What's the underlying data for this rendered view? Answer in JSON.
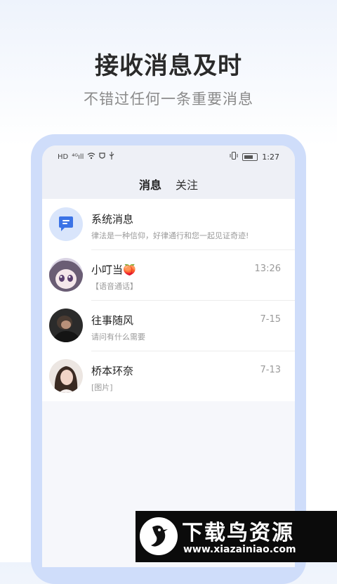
{
  "promo": {
    "headline": "接收消息及时",
    "subline": "不错过任何一条重要消息"
  },
  "statusbar": {
    "left_icons": [
      "HD",
      "4G-signal",
      "wifi",
      "usb"
    ],
    "time": "1:27"
  },
  "tabs": [
    {
      "label": "消息",
      "active": true
    },
    {
      "label": "关注",
      "active": false
    }
  ],
  "messages": [
    {
      "title": "系统消息",
      "preview": "律法是一种信仰，好律通行和您一起见证奇迹!",
      "time": "",
      "icon": "chat-bubble-icon"
    },
    {
      "title": "小叮当🍑",
      "preview": "【语音通话】",
      "time": "13:26",
      "icon": "avatar"
    },
    {
      "title": "往事随风",
      "preview": "请问有什么需要",
      "time": "7-15",
      "icon": "avatar"
    },
    {
      "title": "桥本环奈",
      "preview": "[图片]",
      "time": "7-13",
      "icon": "avatar"
    }
  ],
  "watermark": {
    "title": "下载鸟资源",
    "url": "www.xiazainiao.com"
  },
  "colors": {
    "accent": "#3b73e6",
    "phone_frame": "#cfddfa"
  }
}
